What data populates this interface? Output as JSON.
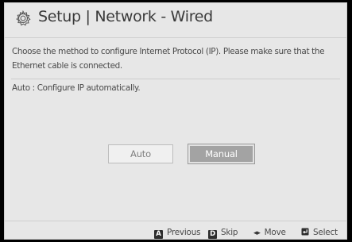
{
  "header": {
    "title": "Setup | Network - Wired",
    "icon": "gear-icon"
  },
  "main": {
    "description": "Choose the method to configure Internet Protocol (IP). Please make sure that the Ethernet cable is connected.",
    "subtitle": "Auto : Configure IP automatically."
  },
  "buttons": {
    "auto_label": "Auto",
    "manual_label": "Manual"
  },
  "footer": {
    "previous": {
      "key": "A",
      "label": "Previous"
    },
    "skip": {
      "key": "D",
      "label": "Skip"
    },
    "move": {
      "glyph": "◂▸",
      "label": "Move"
    },
    "select": {
      "icon": "enter-icon",
      "label": "Select"
    }
  },
  "colors": {
    "background": "#e7e7e7",
    "text": "#3c3c3c",
    "selected_button": "#a3a3a3"
  }
}
